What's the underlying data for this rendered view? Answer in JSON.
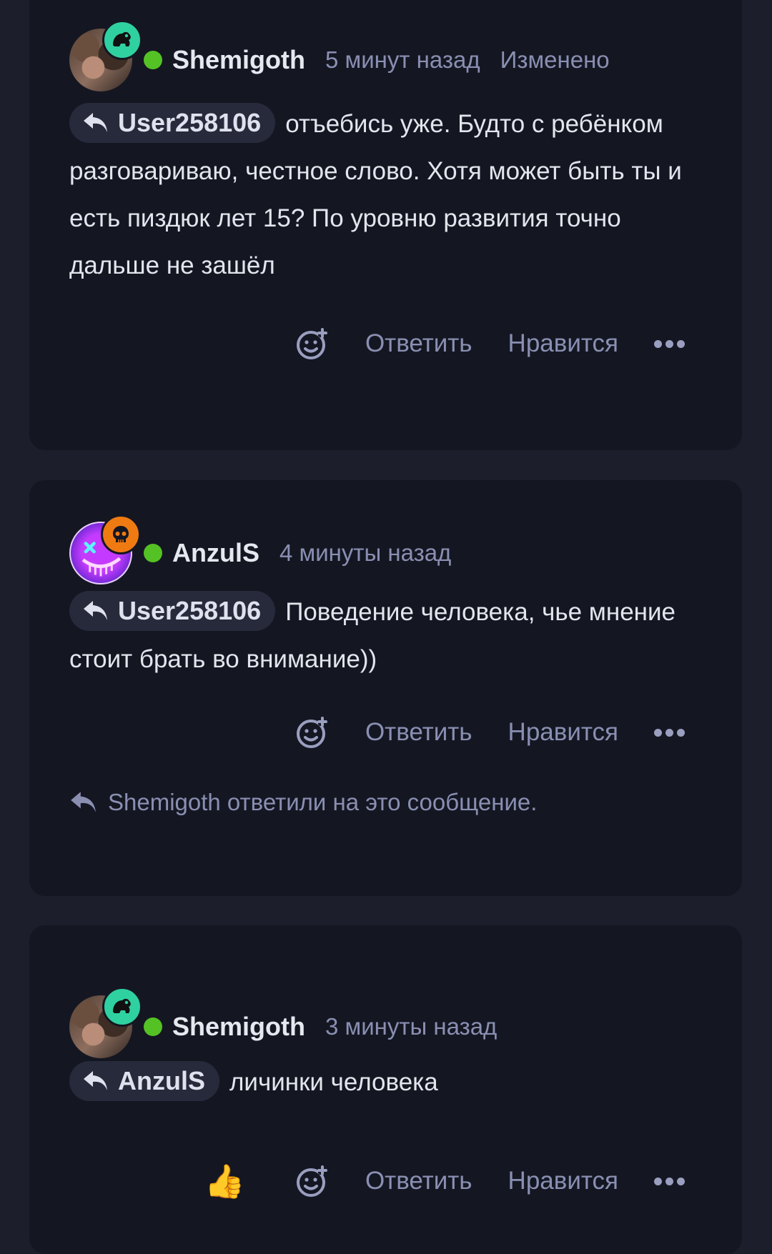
{
  "comments": [
    {
      "author": "Shemigoth",
      "time": "5 минут назад",
      "edited": "Изменено",
      "reply_to": "User258106",
      "text": "отъебись уже. Будто с ребёнком разговариваю, честное слово. Хотя может быть ты и есть пиздюк лет 15? По уровню развития точно дальше не зашёл",
      "actions": {
        "reply": "Ответить",
        "like": "Нравится"
      }
    },
    {
      "author": "AnzulS",
      "time": "4 минуты назад",
      "reply_to": "User258106",
      "text": "Поведение человека, чье мнение стоит брать во внимание))",
      "actions": {
        "reply": "Ответить",
        "like": "Нравится"
      },
      "replied_note": "Shemigoth ответили на это сообщение."
    },
    {
      "author": "Shemigoth",
      "time": "3 минуты назад",
      "reply_to": "AnzulS",
      "text": "личинки человека",
      "reaction": "👍",
      "actions": {
        "reply": "Ответить",
        "like": "Нравится"
      }
    }
  ],
  "colors": {
    "background": "#1c1f2b",
    "card": "#141722",
    "online": "#54c224",
    "badge_green": "#2fd1a0",
    "badge_orange": "#f07a12"
  },
  "icons": [
    "frog-badge-icon",
    "skull-badge-icon",
    "reply-arrow-icon",
    "add-reaction-icon",
    "more-dots-icon",
    "thumbs-up-icon"
  ]
}
